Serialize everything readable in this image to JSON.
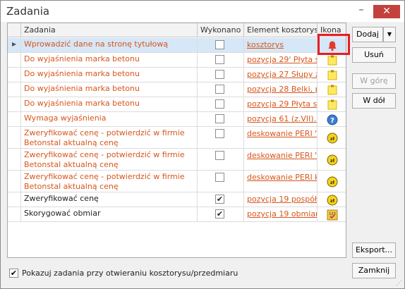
{
  "window": {
    "title": "Zadania",
    "minimize_glyph": "–",
    "close_glyph": "✕"
  },
  "grid": {
    "columns": {
      "task": "Zadania",
      "done": "Wykonano",
      "element": "Element kosztorysu",
      "icon": "Ikona"
    },
    "rows": [
      {
        "task": "Wprowadzić dane na stronę tytułową",
        "done": false,
        "element": "kosztorys",
        "icon": "bell-icon",
        "color": "orange",
        "selected": true
      },
      {
        "task": "Do wyjaśnienia marka betonu",
        "done": false,
        "element": "pozycja 29' Płyta s...",
        "icon": "note-icon",
        "color": "orange"
      },
      {
        "task": "Do wyjaśnienia marka betonu",
        "done": false,
        "element": "pozycja 27 Słupy ż...",
        "icon": "note-icon",
        "color": "orange"
      },
      {
        "task": "Do wyjaśnienia marka betonu",
        "done": false,
        "element": "pozycja 28 Belki, p...",
        "icon": "note-icon",
        "color": "orange"
      },
      {
        "task": "Do wyjaśnienia marka betonu",
        "done": false,
        "element": "pozycja 29 Płyta s...",
        "icon": "note-icon",
        "color": "orange"
      },
      {
        "task": "Wymaga wyjaśnienia",
        "done": false,
        "element": "pozycja 61 (z.VII)...",
        "icon": "question-icon",
        "color": "orange"
      },
      {
        "task": "Zweryfikować cenę - potwierdzić w firmie Betonstal aktualną cenę",
        "done": false,
        "element": "deskowanie PERI \"...",
        "icon": "coin-icon",
        "color": "orange"
      },
      {
        "task": "Zweryfikować cenę - potwierdzić w firmie Betonstal aktualną cenę",
        "done": false,
        "element": "deskowanie PERI \"...",
        "icon": "coin-icon",
        "color": "orange"
      },
      {
        "task": "Zweryfikować cenę - potwierdzić w firmie Betonstal aktualną cenę",
        "done": false,
        "element": "deskowanie PERI k...",
        "icon": "coin-icon",
        "color": "orange"
      },
      {
        "task": "Zweryfikować cenę",
        "done": true,
        "element": "pozycja 19 pospół...",
        "icon": "coin-icon",
        "color": "dark"
      },
      {
        "task": "Skorygować obmiar",
        "done": true,
        "element": "pozycja 19 obmiar...",
        "icon": "measure-icon",
        "color": "dark"
      }
    ]
  },
  "buttons": {
    "add": "Dodaj",
    "remove": "Usuń",
    "up": "W górę",
    "down": "W dół",
    "export": "Eksport...",
    "close": "Zamknij"
  },
  "footer": {
    "show_on_open_label": "Pokazuj zadania przy otwieraniu kosztorysu/przedmiaru",
    "show_on_open_checked": true
  },
  "colors": {
    "orange": "#d7561b",
    "selected_row": "#d6e7f7",
    "highlight": "#e41e26"
  }
}
